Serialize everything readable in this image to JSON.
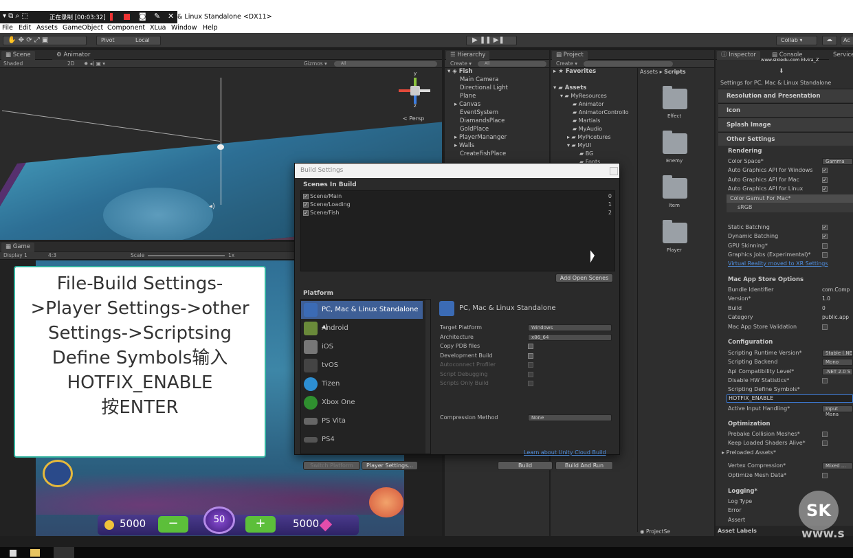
{
  "recorder": {
    "status": "正在录制 [00:03:32]"
  },
  "window": {
    "title": "& Linux Standalone <DX11>"
  },
  "menu": [
    "File",
    "Edit",
    "Assets",
    "GameObject",
    "Component",
    "XLua",
    "Window",
    "Help"
  ],
  "toolbar": {
    "pivot": "Pivot",
    "local": "Local",
    "collab": "Collab ▾",
    "account": "Ac"
  },
  "scene": {
    "tab": "Scene",
    "tab2": "Animator",
    "shading": "Shaded",
    "mode2d": "2D",
    "gizmos": "Gizmos ▾",
    "search": "All",
    "persp": "< Persp",
    "axis_y": "y",
    "axis_z": "z"
  },
  "game": {
    "tab": "Game",
    "display": "Display 1",
    "aspect": "4:3",
    "scale_label": "Scale",
    "scale_val": "1x",
    "coins_left": "5000",
    "bet": "50",
    "coins_right": "5000"
  },
  "callout": {
    "line1": "File-Build Settings-",
    "line2": ">Player Settings->other",
    "line3": "Settings->Scriptsing",
    "line4": "Define Symbols输入",
    "line5": "HOTFIX_ENABLE",
    "line6": "按ENTER"
  },
  "hierarchy": {
    "tab": "Hierarchy",
    "create": "Create ▾",
    "search": "All",
    "root": "Fish",
    "items": [
      "Main Camera",
      "Directional Light",
      "Plane",
      "Canvas",
      "EventSystem",
      "DiamandsPlace",
      "GoldPlace",
      "PlayerMananger",
      "Walls",
      "CreateFishPlace"
    ]
  },
  "project": {
    "tab": "Project",
    "create": "Create ▾",
    "favorites": "Favorites",
    "assets": "Assets",
    "tree": [
      "MyResources",
      "Animator",
      "AnimatorControllo",
      "Martials",
      "MyAudio",
      "MyPicetures",
      "MyUI",
      "BG",
      "Fonts"
    ],
    "breadcrumb_root": "Assets",
    "breadcrumb_leaf": "Scripts",
    "folders": [
      "Effect",
      "Enemy",
      "Item",
      "Player"
    ],
    "footer": "ProjectSe"
  },
  "inspector": {
    "tab": "Inspector",
    "tab2": "Console",
    "tab3": "Services",
    "watermark": "www.sikiedu.com Elvira_Z",
    "header": "Settings for PC, Mac & Linux Standalone",
    "sections": [
      "Resolution and Presentation",
      "Icon",
      "Splash Image",
      "Other Settings"
    ],
    "rendering": "Rendering",
    "color_space": "Color Space*",
    "color_space_val": "Gamma",
    "api_win": "Auto Graphics API for Windows",
    "api_mac": "Auto Graphics API for Mac",
    "api_linux": "Auto Graphics API for Linux",
    "gamut": "Color Gamut For Mac*",
    "srgb": "sRGB",
    "static_batching": "Static Batching",
    "dynamic_batching": "Dynamic Batching",
    "gpu_skinning": "GPU Skinning*",
    "graphics_jobs": "Graphics Jobs (Experimental)*",
    "vr_link": "Virtual Reality moved to XR Settings",
    "mac_store": "Mac App Store Options",
    "bundle_id": "Bundle Identifier",
    "bundle_id_val": "com.Comp",
    "version": "Version*",
    "version_val": "1.0",
    "build": "Build",
    "build_val": "0",
    "category": "Category",
    "category_val": "public.app",
    "validation": "Mac App Store Validation",
    "configuration": "Configuration",
    "runtime": "Scripting Runtime Version*",
    "runtime_val": "Stable (.NE",
    "backend": "Scripting Backend",
    "backend_val": "Mono",
    "api_level": "Api Compatibility Level*",
    ".net": ".NET 2.0 S",
    "disable_hw": "Disable HW Statistics*",
    "define_symbols": "Scripting Define Symbols*",
    "define_val": "HOTFIX_ENABLE",
    "input": "Active Input Handling*",
    "input_val": "Input Mana",
    "optimization": "Optimization",
    "prebake": "Prebake Collision Meshes*",
    "keep_shaders": "Keep Loaded Shaders Alive*",
    "preloaded": "Preloaded Assets*",
    "vertex": "Vertex Compression*",
    "vertex_val": "Mixed ...",
    "optimize_mesh": "Optimize Mesh Data*",
    "logging": "Logging*",
    "log_type": "Log Type",
    "error": "Error",
    "assert": "Assert",
    "asset_labels": "Asset Labels"
  },
  "build": {
    "title": "Build Settings",
    "scenes_header": "Scenes In Build",
    "scenes": [
      {
        "name": "Scene/Main",
        "index": "0"
      },
      {
        "name": "Scene/Loading",
        "index": "1"
      },
      {
        "name": "Scene/Fish",
        "index": "2"
      }
    ],
    "add_open": "Add Open Scenes",
    "platform_header": "Platform",
    "platforms": [
      "PC, Mac & Linux Standalone",
      "Android",
      "iOS",
      "tvOS",
      "Tizen",
      "Xbox One",
      "PS Vita",
      "PS4"
    ],
    "selected_title": "PC, Mac & Linux Standalone",
    "target_platform": "Target Platform",
    "target_val": "Windows",
    "architecture": "Architecture",
    "arch_val": "x86_64",
    "copy_pdb": "Copy PDB files",
    "dev_build": "Development Build",
    "autoconnect": "Autoconnect Profiler",
    "script_debug": "Script Debugging",
    "scripts_only": "Scripts Only Build",
    "compression": "Compression Method",
    "compression_val": "None",
    "cloud_link": "Learn about Unity Cloud Build",
    "switch_platform": "Switch Platform",
    "player_settings": "Player Settings...",
    "build_btn": "Build",
    "build_run": "Build And Run"
  },
  "logo": {
    "letters": "SK",
    "site": "www.s"
  }
}
